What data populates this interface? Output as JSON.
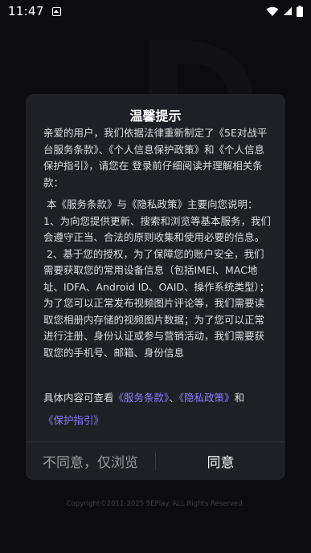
{
  "status_bar": {
    "time": "11:47"
  },
  "dialog": {
    "title": "温馨提示",
    "intro": "亲爱的用户，我们依据法律重新制定了《5E对战平台服务条款》、《个人信息保护政策》和《个人信息保护指引》，请您在 登录前仔细阅读并理解相关条款：",
    "policy_heading": "本《服务条款》与《隐私政策》主要向您说明：",
    "policy_item_1": "1、为向您提供更新、搜索和浏览等基本服务，我们会遵守正当、合法的原则收集和使用必要的信息。",
    "policy_item_2": "2、基于您的授权，为了保障您的账户安全，我们需要获取您的常用设备信息（包括IMEI、MAC地址、IDFA、Android ID、OAID、操作系统类型）；为了您可以正常发布视频图片评论等，我们需要读取您相册内存储的视频图片数据；为了您可以正常进行注册、身份认证或参与营销活动，我们需要获取您的手机号、邮箱、身份信息",
    "footer_prefix": "具体内容可查看",
    "link_terms": "《服务条款》",
    "separator": "、",
    "link_privacy": "《隐私政策》",
    "and": "和",
    "link_guide": "《保护指引》",
    "btn_disagree": "不同意，仅浏览",
    "btn_agree": "同意"
  },
  "copyright": "Copyright©2011-2025 5EPlay. ALL Rights Reserved."
}
